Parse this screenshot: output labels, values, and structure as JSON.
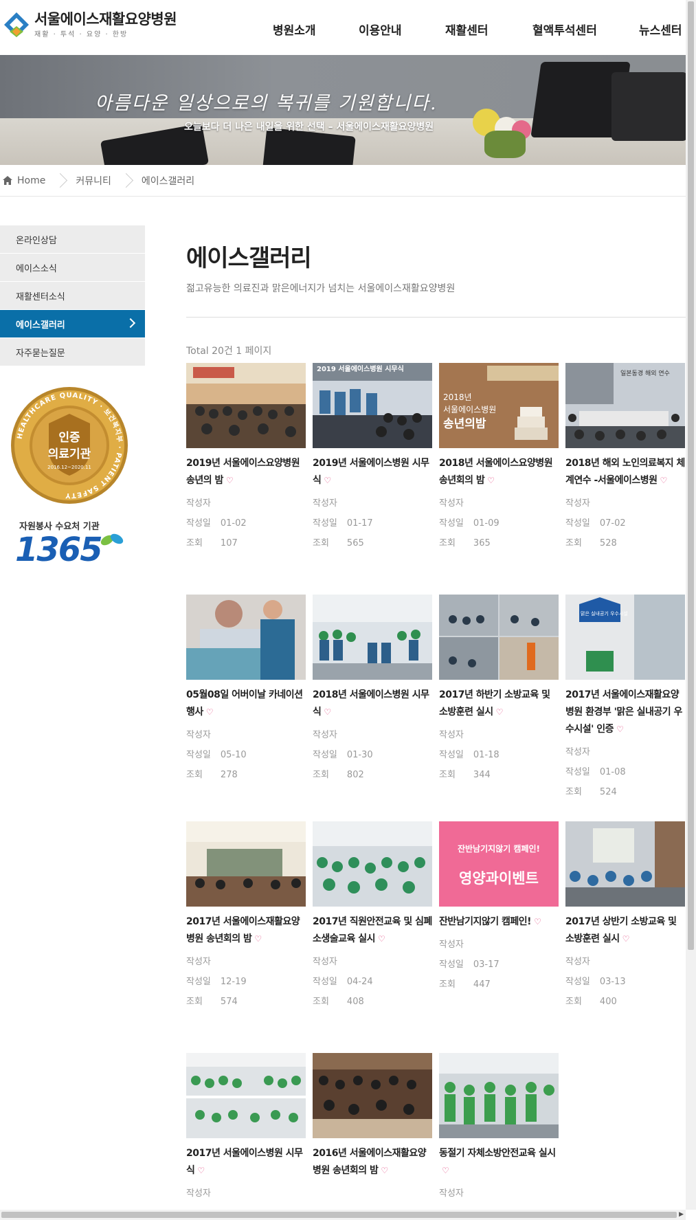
{
  "header": {
    "logo_name": "서울에이스재활요양병원",
    "logo_sub": "재활 · 투석 · 요양 · 한방",
    "nav": [
      "병원소개",
      "이용안내",
      "재활센터",
      "혈액투석센터",
      "뉴스센터"
    ]
  },
  "banner": {
    "title": "아름다운 일상으로의 복귀를 기원합니다.",
    "subtitle": "오늘보다 더 나은 내일을 위한 선택 – 서울에이스재활요양병원"
  },
  "breadcrumb": [
    "Home",
    "커뮤니티",
    "에이스갤러리"
  ],
  "sidebar": {
    "items": [
      {
        "label": "온라인상담"
      },
      {
        "label": "에이스소식"
      },
      {
        "label": "재활센터소식"
      },
      {
        "label": "에이스갤러리"
      },
      {
        "label": "자주묻는질문"
      }
    ],
    "active_index": 3,
    "badge_center": "인증",
    "badge_center2": "의료기관",
    "badge_ring": "HEALTHCARE QUALITY · 보건복지부 · PATIENT SAFETY",
    "badge_date": "2016.12~2020.11",
    "volunteer_title": "자원봉사 수요처 기관",
    "volunteer_num": "1365"
  },
  "content": {
    "title": "에이스갤러리",
    "desc": "젊고유능한 의료진과 맑은에너지가 넘치는 서울에이스재활요양병원",
    "total": "Total 20건 1 페이지"
  },
  "labels": {
    "author": "작성자",
    "date": "작성일",
    "views": "조회"
  },
  "posts": [
    {
      "title": "2019년 서울에이스요양병원 송년의 밤",
      "date": "01-02",
      "views": "107"
    },
    {
      "title": "2019년 서울에이스병원 시무식",
      "date": "01-17",
      "views": "565"
    },
    {
      "title": "2018년 서울에이스요양병원 송년회의 밤",
      "date": "01-09",
      "views": "365"
    },
    {
      "title": "2018년 해외 노인의료복지 체계연수 -서울에이스병원",
      "date": "07-02",
      "views": "528"
    },
    {
      "title": "05월08일 어버이날 카네이션 행사",
      "date": "05-10",
      "views": "278"
    },
    {
      "title": "2018년 서울에이스병원 시무식",
      "date": "01-30",
      "views": "802"
    },
    {
      "title": "2017년 하반기 소방교육 및 소방훈련 실시",
      "date": "01-18",
      "views": "344"
    },
    {
      "title": "2017년 서울에이스재활요양병원 환경부 '맑은 실내공기 우수시설' 인증",
      "date": "01-08",
      "views": "524"
    },
    {
      "title": "2017년 서울에이스재활요양병원 송년회의 밤",
      "date": "12-19",
      "views": "574"
    },
    {
      "title": "2017년 직원안전교육 및 심폐소생술교육 실시",
      "date": "04-24",
      "views": "408"
    },
    {
      "title": "잔반남기지않기 캠페인!",
      "date": "03-17",
      "views": "447"
    },
    {
      "title": "2017년 상반기 소방교육 및 소방훈련 실시",
      "date": "03-13",
      "views": "400"
    },
    {
      "title": "2017년 서울에이스병원 시무식",
      "date": "",
      "views": ""
    },
    {
      "title": "2016년 서울에이스재활요양병원 송년회의 밤",
      "date": "",
      "views": ""
    },
    {
      "title": "동절기 자체소방안전교육 실시",
      "date": "",
      "views": ""
    }
  ],
  "thumb_text": {
    "t1": "2019 서울에이스병원 시무식",
    "t2a": "2018년",
    "t2b": "서울에이스병원",
    "t2c": "송년의밤",
    "t3": "일본동경 해외 연수",
    "t7": "맑은 실내공기 우수시설",
    "t10a": "잔반남기지않기 캠페인!",
    "t10b": "영양과이벤트"
  }
}
